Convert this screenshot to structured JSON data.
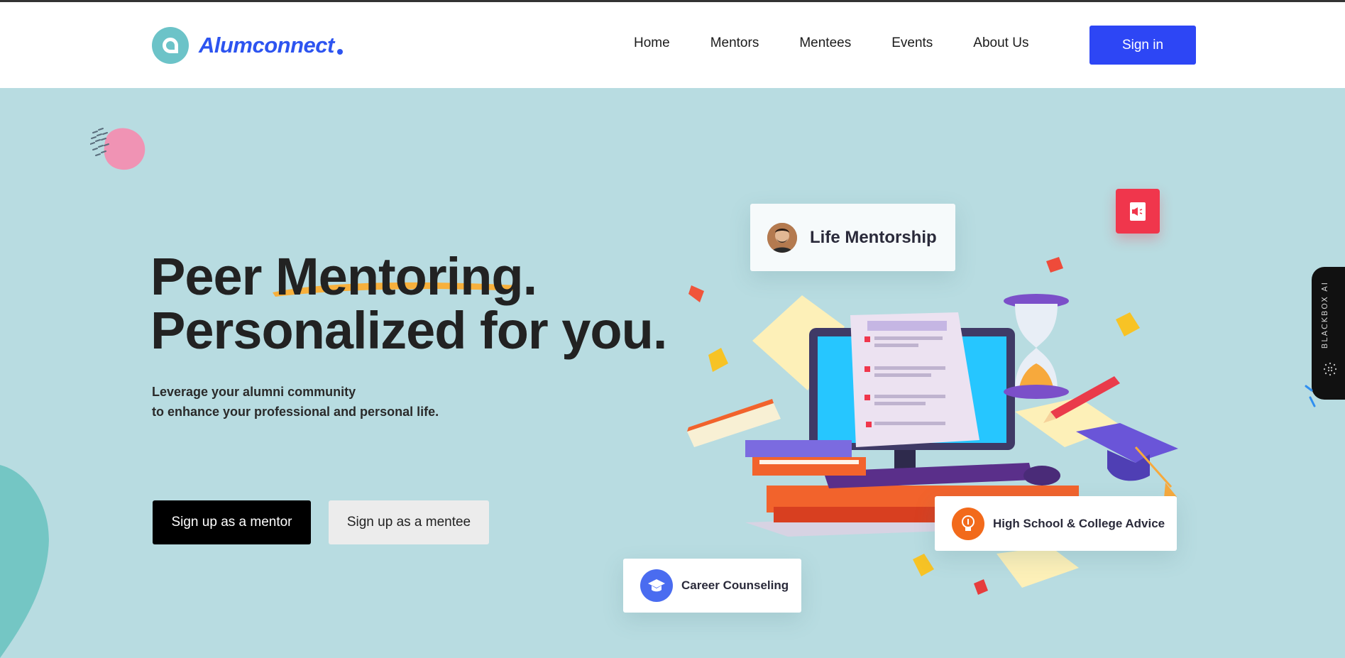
{
  "brand": {
    "name": "Alumconnect"
  },
  "nav": {
    "items": [
      "Home",
      "Mentors",
      "Mentees",
      "Events",
      "About Us"
    ],
    "signin_label": "Sign in"
  },
  "hero": {
    "title_word_1": "Peer",
    "title_highlight": "Mentoring",
    "title_period": ".",
    "title_line_2": "Personalized for you.",
    "subtitle_line_1": "Leverage your alumni community",
    "subtitle_line_2": "to enhance your professional and personal life.",
    "mentor_button": "Sign up as a mentor",
    "mentee_button": "Sign up as a mentee"
  },
  "cards": {
    "life": "Life Mentorship",
    "highschool": "High School & College Advice",
    "career": "Career Counseling"
  },
  "side_tab": {
    "label": "BLACKBOX AI"
  },
  "colors": {
    "brand_blue": "#2d54f0",
    "signin_blue": "#2d46f5",
    "hero_bg": "#b8dce1",
    "logo_teal": "#6cc3c8",
    "accent_red": "#f0364c",
    "highlight_orange": "#f7b03c"
  },
  "icons": {
    "logo": "alumconnect-logo-icon",
    "badge": "megaphone-book-icon",
    "hs": "lightbulb-icon",
    "career": "graduation-cap-icon"
  }
}
